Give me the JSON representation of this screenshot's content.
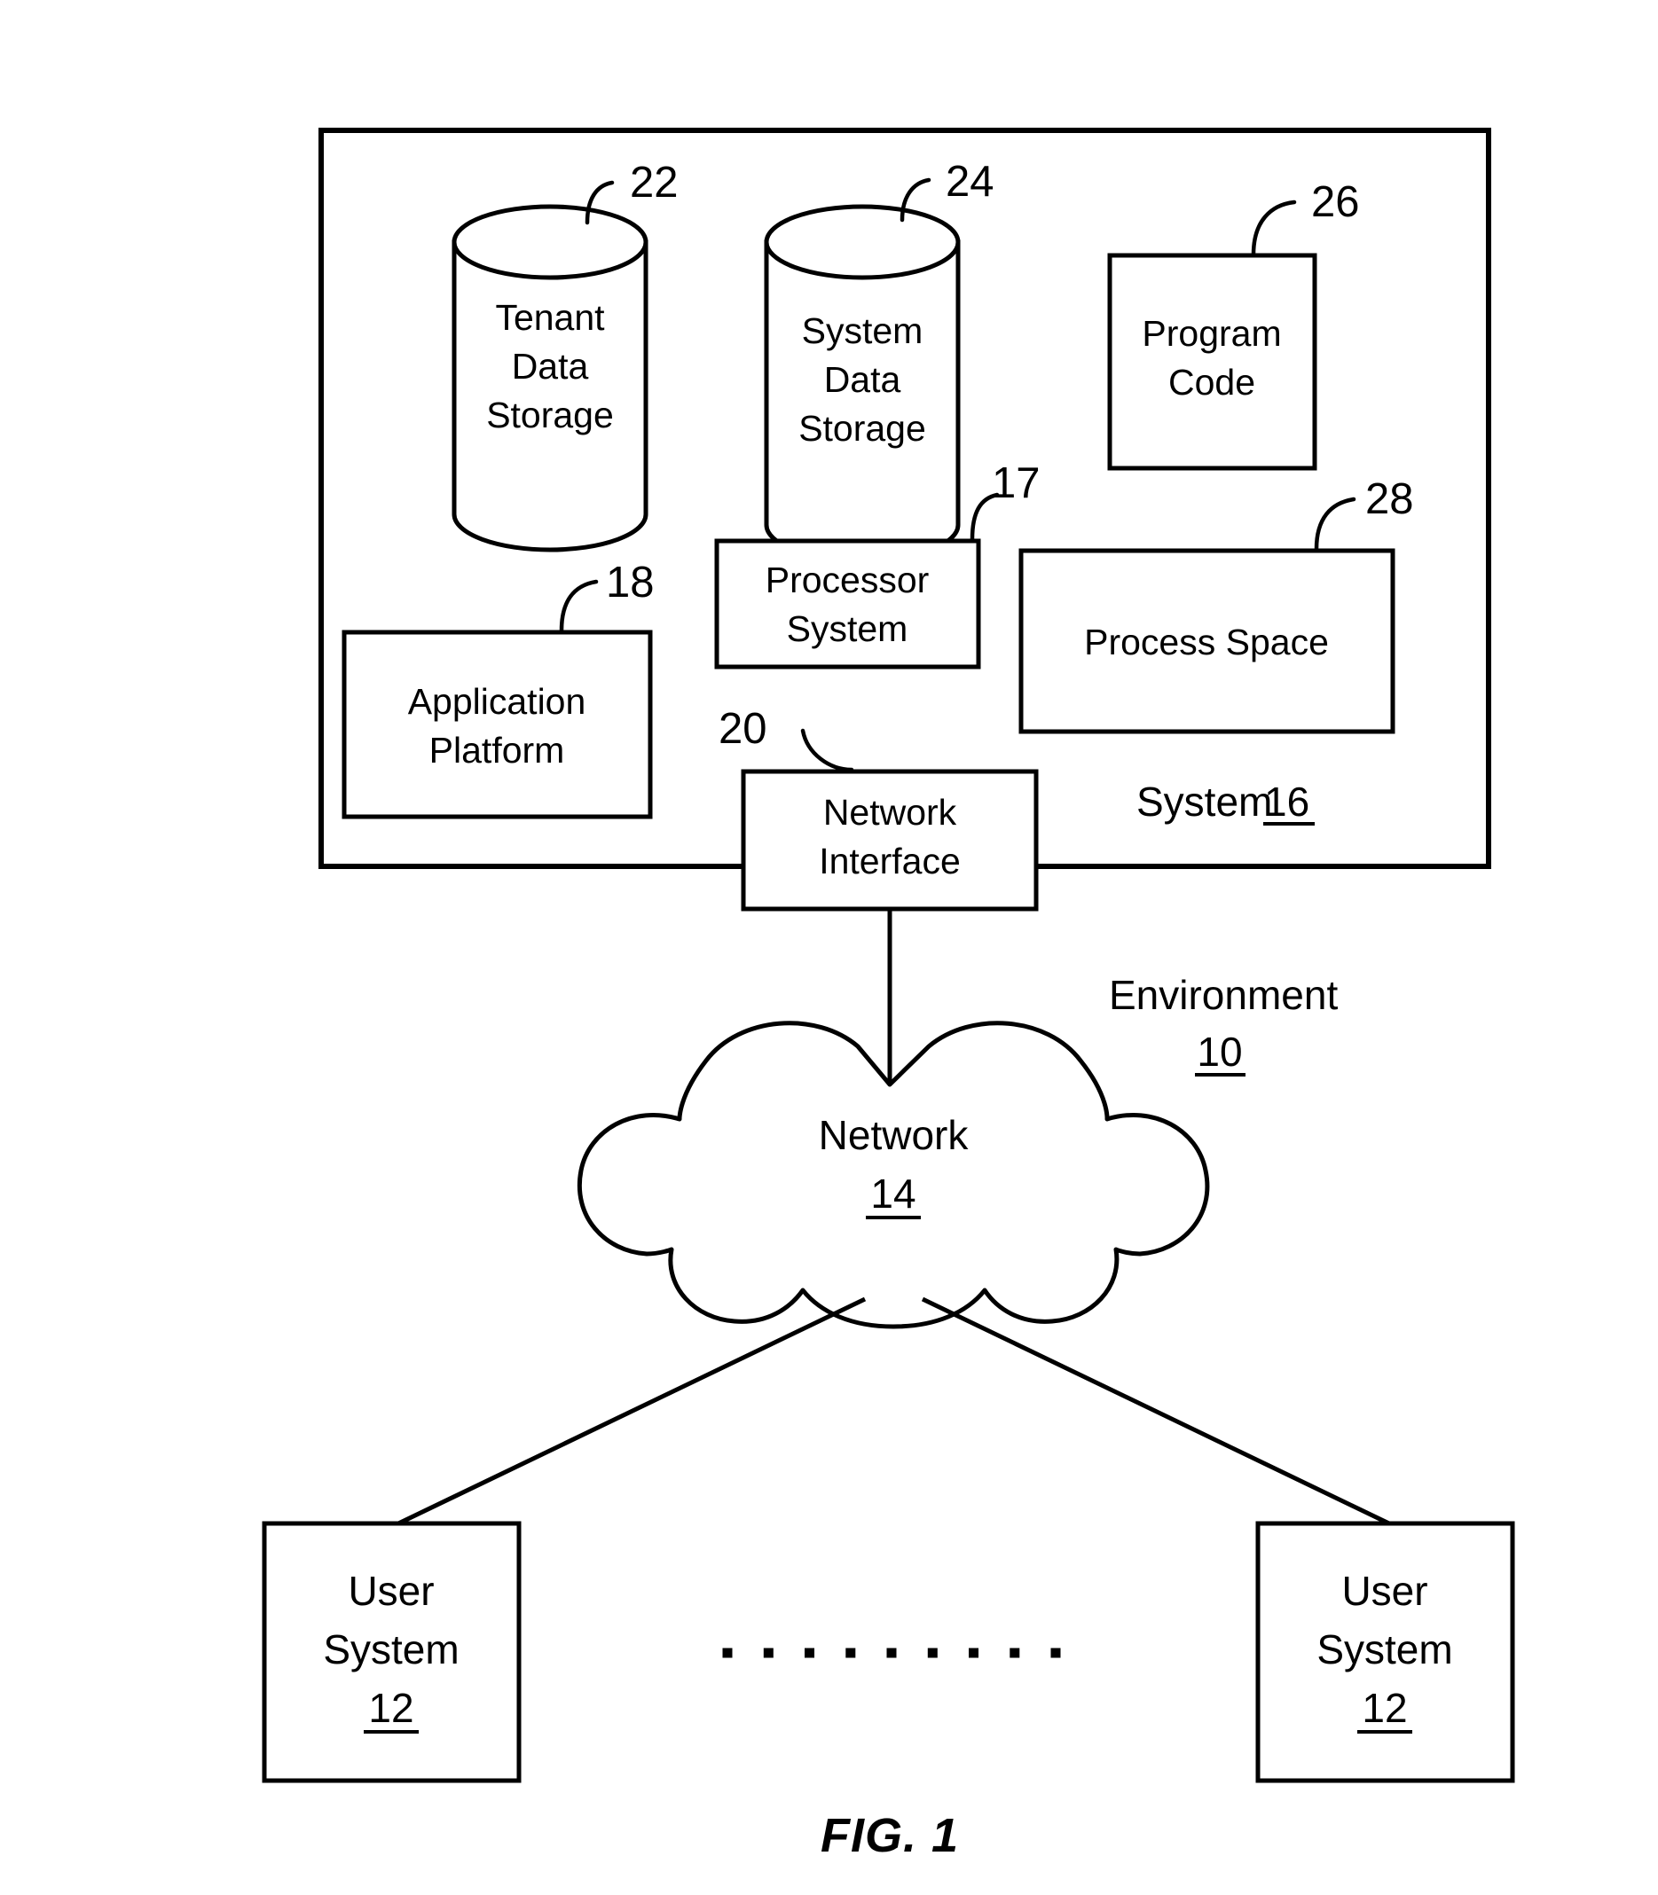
{
  "figure": {
    "caption": "FIG. 1",
    "title": "Environment 10 system architecture diagram"
  },
  "environment": {
    "label": "Environment",
    "ref": "10"
  },
  "system_block": {
    "label": "System",
    "ref": "16"
  },
  "components": {
    "tenant_data_storage": {
      "line1": "Tenant",
      "line2": "Data",
      "line3": "Storage",
      "ref": "22",
      "shape": "cylinder"
    },
    "system_data_storage": {
      "line1": "System",
      "line2": "Data",
      "line3": "Storage",
      "ref": "24",
      "shape": "cylinder"
    },
    "program_code": {
      "line1": "Program",
      "line2": "Code",
      "ref": "26",
      "shape": "rectangle"
    },
    "processor_system": {
      "line1": "Processor",
      "line2": "System",
      "ref": "17",
      "shape": "rectangle"
    },
    "process_space": {
      "line1": "Process Space",
      "ref": "28",
      "shape": "rectangle"
    },
    "application_platform": {
      "line1": "Application",
      "line2": "Platform",
      "ref": "18",
      "shape": "rectangle"
    },
    "network_interface": {
      "line1": "Network",
      "line2": "Interface",
      "ref": "20",
      "shape": "rectangle"
    },
    "network": {
      "line1": "Network",
      "ref": "14",
      "shape": "cloud"
    },
    "user_system_left": {
      "line1": "User",
      "line2": "System",
      "ref": "12",
      "shape": "rectangle"
    },
    "user_system_right": {
      "line1": "User",
      "line2": "System",
      "ref": "12",
      "shape": "rectangle"
    }
  },
  "ellipsis": {
    "dot_count": 9,
    "meaning": "additional user systems"
  },
  "colors": {
    "stroke": "#000000",
    "fill": "#ffffff",
    "background": "#ffffff"
  }
}
